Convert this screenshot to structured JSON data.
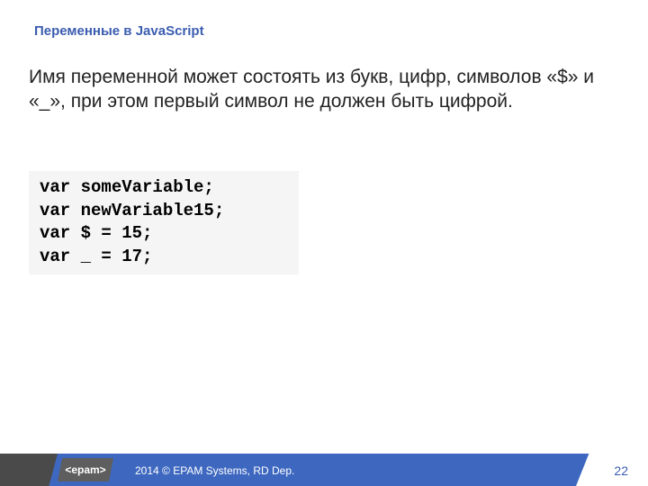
{
  "title": "Переменные в JavaScript",
  "body": "Имя переменной может состоять из букв, цифр, символов «$» и «_», при этом первый символ не должен быть цифрой.",
  "code": "var someVariable;\nvar newVariable15;\nvar $ = 15;\nvar _ = 17;",
  "footer": {
    "logo": "<epam>",
    "copyright": "2014 © EPAM Systems, RD Dep.",
    "page": "22"
  }
}
